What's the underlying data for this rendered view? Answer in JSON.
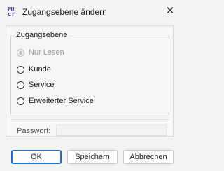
{
  "window": {
    "title": "Zugangsebene ändern",
    "app_icon_text": "MI CT",
    "close_glyph": "✕"
  },
  "access_group": {
    "legend": "Zugangsebene",
    "options": [
      {
        "label": "Nur Lesen",
        "enabled": false,
        "selected": true
      },
      {
        "label": "Kunde",
        "enabled": true,
        "selected": false
      },
      {
        "label": "Service",
        "enabled": true,
        "selected": false
      },
      {
        "label": "Erweiterter Service",
        "enabled": true,
        "selected": false
      }
    ]
  },
  "password": {
    "label": "Passwort:",
    "value": ""
  },
  "buttons": {
    "ok": "OK",
    "save": "Speichern",
    "cancel": "Abbrechen"
  },
  "colors": {
    "accent": "#1f6fc5",
    "icon": "#3b3f8a"
  }
}
